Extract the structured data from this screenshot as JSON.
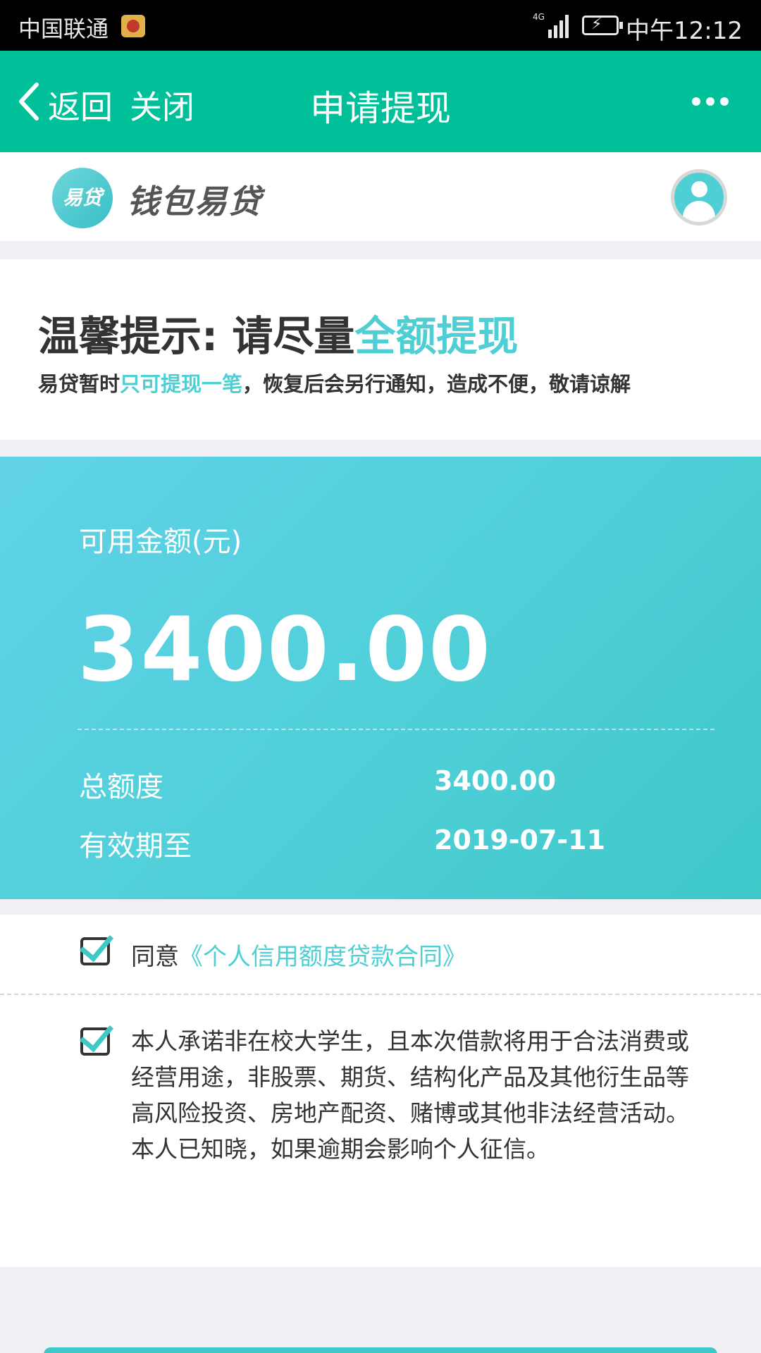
{
  "status_bar": {
    "carrier": "中国联通",
    "network": "4G",
    "time": "中午12:12"
  },
  "title_bar": {
    "back_label": "返回",
    "close_label": "关闭",
    "title": "申请提现"
  },
  "brand": {
    "logo_text": "易贷",
    "name": "钱包易贷"
  },
  "notice": {
    "title_prefix": "温馨提示: 请尽量",
    "title_highlight": "全额提现",
    "body_prefix": "易贷暂时",
    "body_highlight": "只可提现一笔",
    "body_suffix": "，恢复后会另行通知，造成不便，敬请谅解"
  },
  "amount_card": {
    "available_label": "可用金额(元)",
    "available_value": "3400.00",
    "total_label": "总额度",
    "total_value": "3400.00",
    "valid_label": "有效期至",
    "valid_value": "2019-07-11"
  },
  "agreements": {
    "agree_prefix": "同意",
    "contract_link": "《个人信用额度贷款合同》",
    "agree_checked": true,
    "commitment_text": "本人承诺非在校大学生，且本次借款将用于合法消费或经营用途，非股票、期货、结构化产品及其他衍生品等高风险投资、房地产配资、赌博或其他非法经营活动。本人已知晓，如果逾期会影响个人征信。",
    "commitment_checked": true
  },
  "colors": {
    "header_green": "#00c09a",
    "accent_teal": "#4fcfd3",
    "card_gradient_start": "#60d2e8",
    "card_gradient_end": "#3ec8c8"
  }
}
